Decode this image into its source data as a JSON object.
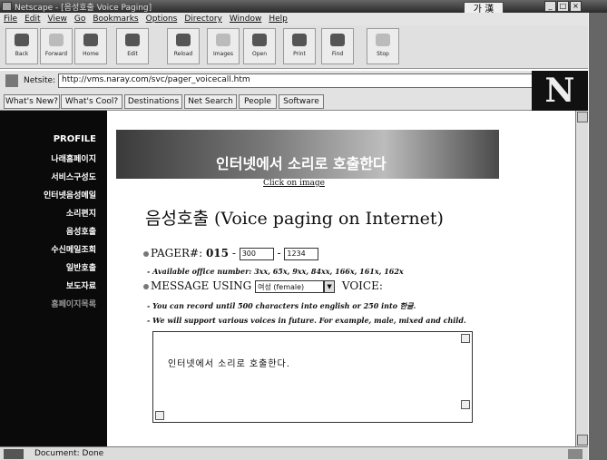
{
  "window": {
    "title": "Netscape - [음성호출 Voice Paging]",
    "ime_label": "가",
    "ime_sub": "漢"
  },
  "menu": [
    "File",
    "Edit",
    "View",
    "Go",
    "Bookmarks",
    "Options",
    "Directory",
    "Window",
    "Help"
  ],
  "toolbar": [
    {
      "label": "Back",
      "icon": "back-icon",
      "enabled": true
    },
    {
      "label": "Forward",
      "icon": "forward-icon",
      "enabled": false
    },
    {
      "label": "Home",
      "icon": "home-icon",
      "enabled": true
    },
    {
      "label": "Edit",
      "icon": "edit-icon",
      "enabled": true
    },
    {
      "label": "Reload",
      "icon": "reload-icon",
      "enabled": true
    },
    {
      "label": "Images",
      "icon": "images-icon",
      "enabled": false
    },
    {
      "label": "Open",
      "icon": "open-icon",
      "enabled": true
    },
    {
      "label": "Print",
      "icon": "print-icon",
      "enabled": true
    },
    {
      "label": "Find",
      "icon": "find-icon",
      "enabled": true
    },
    {
      "label": "Stop",
      "icon": "stop-icon",
      "enabled": false
    }
  ],
  "location": {
    "label": "Netsite:",
    "url": "http://vms.naray.com/svc/pager_voicecall.htm"
  },
  "directory_buttons": [
    "What's New?",
    "What's Cool?",
    "Destinations",
    "Net Search",
    "People",
    "Software"
  ],
  "nav": {
    "items": [
      "PROFILE",
      "나래홈페이지",
      "서비스구성도",
      "인터넷음성메일",
      "소리편지",
      "음성호출",
      "수신메일조회",
      "일반호출",
      "보도자료",
      "홈페이지목록"
    ]
  },
  "banner": {
    "text": "인터넷에서 소리로 호출한다",
    "caption": "Click on image"
  },
  "page": {
    "title": "음성호출 (Voice paging on Internet)",
    "pager_label": "PAGER#: ",
    "pager_prefix": "015",
    "pager_dash": " - ",
    "pager_office": "300",
    "pager_number": "1234",
    "note_office": "- Available office number: 3xx, 65x, 9xx, 84xx, 166x, 161x, 162x",
    "message_label_1": "MESSAGE USING ",
    "voice_select": "여성 (female)",
    "message_label_2": " VOICE:",
    "note_record": "- You can record until 500 characters into english or 250 into 한글.",
    "note_support": "- We will support various voices in future. For example, male, mixed and child.",
    "message_text": "인터넷에서 소리로 호출한다."
  },
  "status": {
    "text": "Document: Done"
  }
}
